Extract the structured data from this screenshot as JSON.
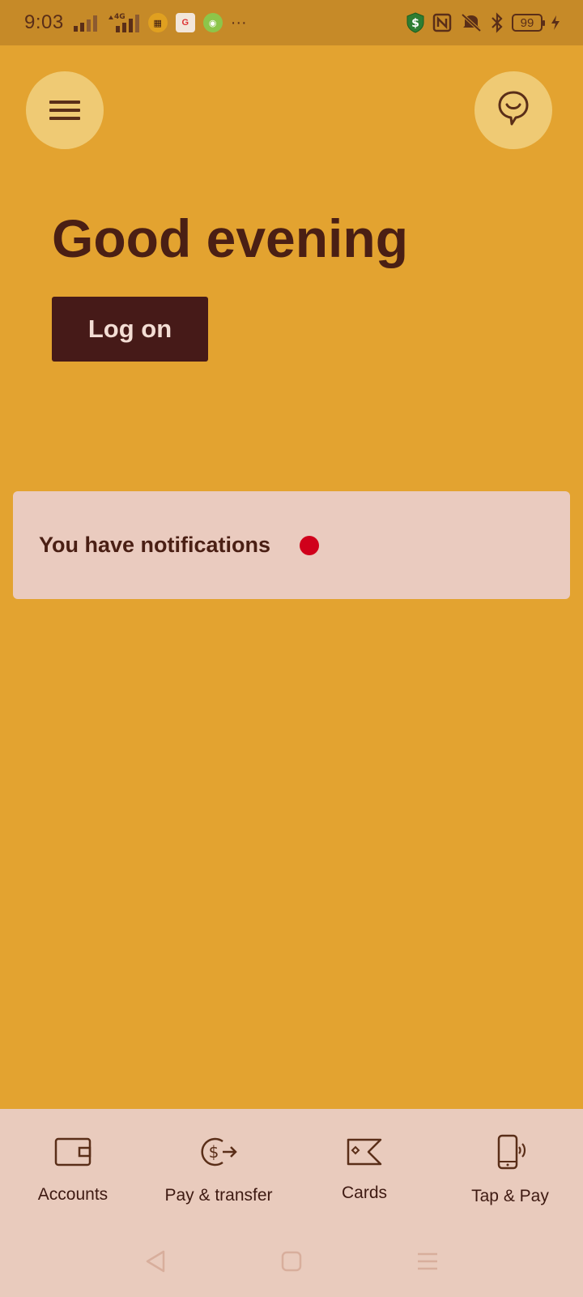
{
  "status_bar": {
    "time": "9:03",
    "network": "4G",
    "battery": "99"
  },
  "header": {
    "menu_icon": "hamburger-icon",
    "chat_icon": "chat-bubble-smile-icon"
  },
  "main": {
    "greeting": "Good evening",
    "logon_label": "Log on"
  },
  "notifications": {
    "label": "You have notifications"
  },
  "bottom_nav": {
    "items": [
      {
        "label": "Accounts",
        "icon": "wallet-icon"
      },
      {
        "label": "Pay & transfer",
        "icon": "pay-transfer-icon"
      },
      {
        "label": "Cards",
        "icon": "card-icon"
      },
      {
        "label": "Tap & Pay",
        "icon": "tap-pay-icon"
      }
    ]
  },
  "colors": {
    "background": "#E3A330",
    "status_bar": "#C68A28",
    "primary_dark": "#461A18",
    "card": "#EACBBF",
    "notification_dot": "#D0001B"
  }
}
